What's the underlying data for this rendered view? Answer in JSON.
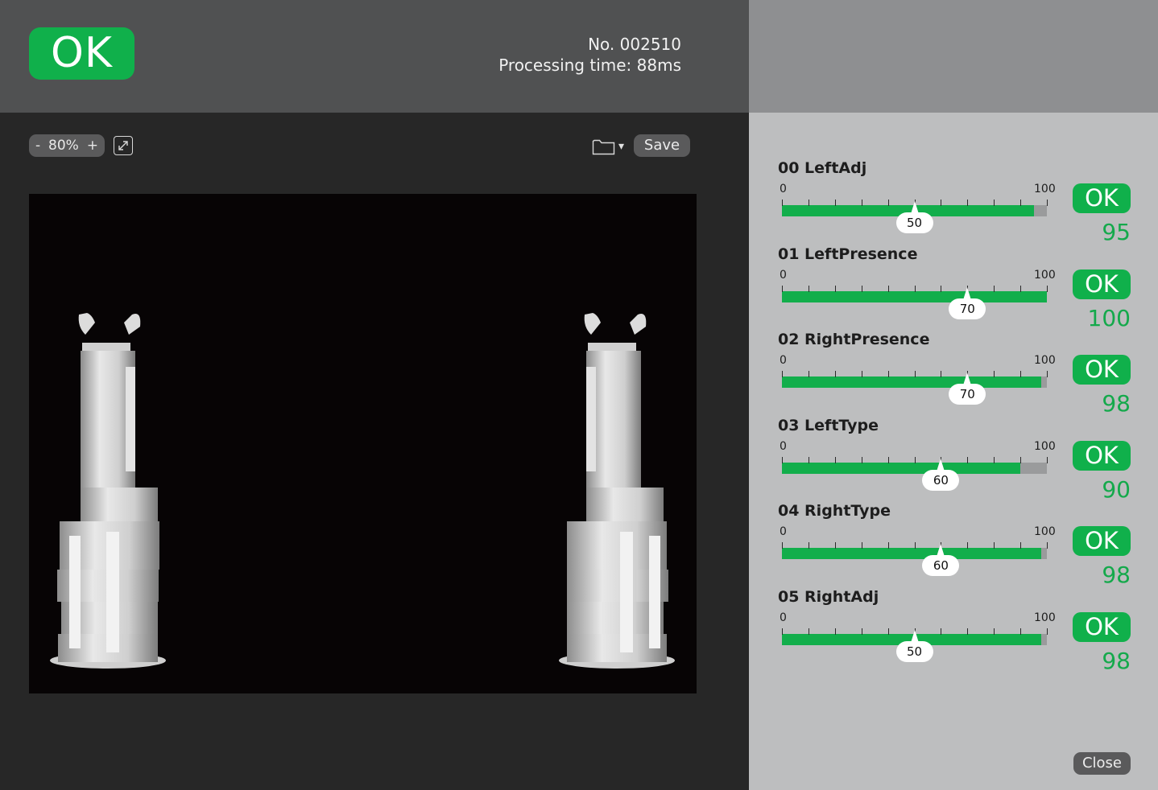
{
  "header": {
    "status": "OK",
    "number": "No. 002510",
    "processing_label": "Processing time:",
    "processing_value": "88ms"
  },
  "toolbar": {
    "zoom_minus": "-",
    "zoom_value": "80%",
    "zoom_plus": "+",
    "folder_caret": "▾",
    "save_label": "Save"
  },
  "colors": {
    "ok_green": "#10b04b",
    "score_green": "#14a94b",
    "track_gray": "#9a9b9c"
  },
  "items": [
    {
      "title": "00 LeftAdj",
      "min": "0",
      "max": "100",
      "threshold": 50,
      "threshold_label": "50",
      "fill": 95,
      "status": "OK",
      "score": "95"
    },
    {
      "title": "01 LeftPresence",
      "min": "0",
      "max": "100",
      "threshold": 70,
      "threshold_label": "70",
      "fill": 100,
      "status": "OK",
      "score": "100"
    },
    {
      "title": "02 RightPresence",
      "min": "0",
      "max": "100",
      "threshold": 70,
      "threshold_label": "70",
      "fill": 98,
      "status": "OK",
      "score": "98"
    },
    {
      "title": "03 LeftType",
      "min": "0",
      "max": "100",
      "threshold": 60,
      "threshold_label": "60",
      "fill": 90,
      "status": "OK",
      "score": "90"
    },
    {
      "title": "04 RightType",
      "min": "0",
      "max": "100",
      "threshold": 60,
      "threshold_label": "60",
      "fill": 98,
      "status": "OK",
      "score": "98"
    },
    {
      "title": "05 RightAdj",
      "min": "0",
      "max": "100",
      "threshold": 50,
      "threshold_label": "50",
      "fill": 98,
      "status": "OK",
      "score": "98"
    }
  ],
  "footer": {
    "close_label": "Close"
  }
}
